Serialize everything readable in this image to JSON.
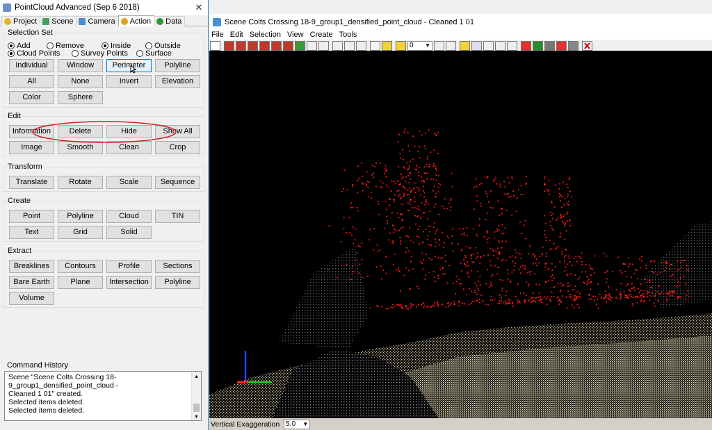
{
  "left_panel": {
    "title": "PointCloud Advanced (Sep  6 2018)",
    "tabs": [
      "Project",
      "Scene",
      "Camera",
      "Action",
      "Data"
    ],
    "active_tab": "Action",
    "selection_set": {
      "title": "Selection Set",
      "mode_options": [
        "Add",
        "Remove",
        "Inside",
        "Outside"
      ],
      "mode_selected": [
        "Add",
        "Inside"
      ],
      "target_options": [
        "Cloud Points",
        "Survey Points",
        "Surface"
      ],
      "target_selected": "Cloud Points",
      "buttons": [
        "Individual",
        "Window",
        "Perimeter",
        "Polyline",
        "All",
        "None",
        "Invert",
        "Elevation",
        "Color",
        "Sphere"
      ]
    },
    "edit": {
      "title": "Edit",
      "buttons": [
        "Information",
        "Delete",
        "Hide",
        "Show All",
        "Image",
        "Smooth",
        "Clean",
        "Crop"
      ]
    },
    "transform": {
      "title": "Transform",
      "buttons": [
        "Translate",
        "Rotate",
        "Scale",
        "Sequence"
      ]
    },
    "create": {
      "title": "Create",
      "buttons": [
        "Point",
        "Polyline",
        "Cloud",
        "TIN",
        "Text",
        "Grid",
        "Solid"
      ]
    },
    "extract": {
      "title": "Extract",
      "buttons": [
        "Breaklines",
        "Contours",
        "Profile",
        "Sections",
        "Bare Earth",
        "Plane",
        "Intersection",
        "Polyline",
        "Volume"
      ]
    },
    "command_history": {
      "title": "Command History",
      "lines": [
        "Scene \"Scene Colts Crossing 18-9_group1_densified_point_cloud -",
        "Cleaned 1 01\" created.",
        "Selected items deleted.",
        "Selected items deleted."
      ]
    }
  },
  "scene_window": {
    "title": "Scene Colts Crossing 18-9_group1_densified_point_cloud - Cleaned 1 01",
    "menu": [
      "File",
      "Edit",
      "Selection",
      "View",
      "Create",
      "Tools"
    ],
    "layer_combo_value": "0",
    "vertical_exaggeration_label": "Vertical Exaggeration",
    "vertical_exaggeration_value": "5.0"
  },
  "colors": {
    "selected_points": "#ff1a1a",
    "annotation_ellipse": "#d42020",
    "hover_button": "#e5f1fb"
  }
}
